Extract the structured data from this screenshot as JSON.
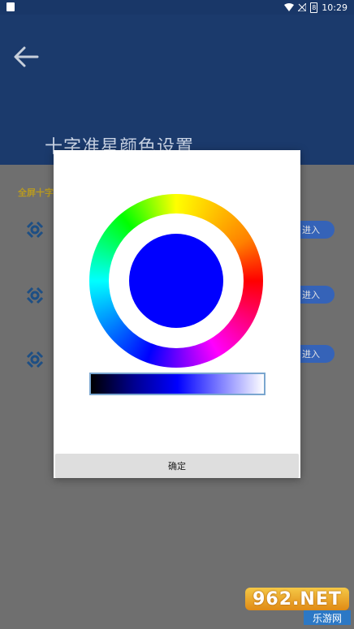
{
  "status_bar": {
    "time": "10:29",
    "battery_level": "8"
  },
  "header": {
    "title": "十字准星颜色设置"
  },
  "content": {
    "section_title": "全屏十字",
    "rows": [
      {
        "button_label": "进入"
      },
      {
        "button_label": "进入"
      },
      {
        "button_label": "进入"
      }
    ]
  },
  "dialog": {
    "selected_color": "#0000ff",
    "confirm_label": "确定"
  },
  "watermark": {
    "logo_text": "962.NET",
    "site_text": "乐游网"
  }
}
